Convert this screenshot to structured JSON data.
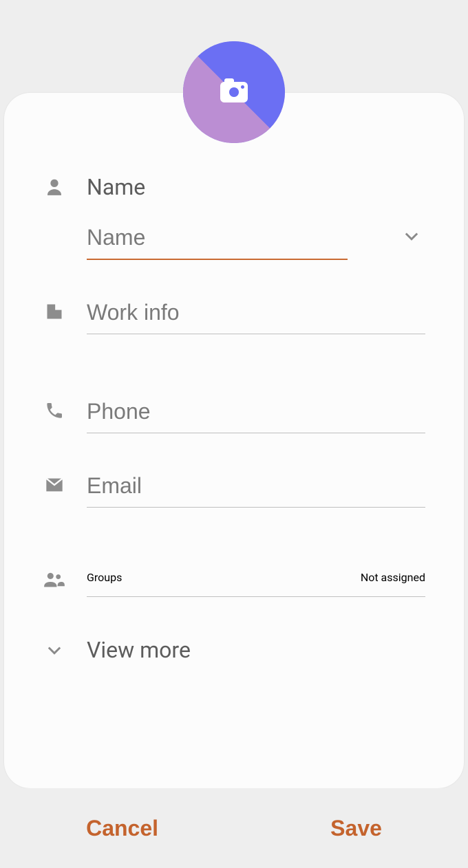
{
  "colors": {
    "accent": "#c4632d"
  },
  "avatar": {
    "icon": "camera-icon"
  },
  "fields": {
    "name": {
      "label": "Name",
      "placeholder": "Name",
      "value": "",
      "icon": "person-icon",
      "expand_icon": "chevron-down-icon"
    },
    "work": {
      "placeholder": "Work info",
      "value": "",
      "icon": "building-icon"
    },
    "phone": {
      "placeholder": "Phone",
      "value": "",
      "icon": "phone-icon"
    },
    "email": {
      "placeholder": "Email",
      "value": "",
      "icon": "mail-icon"
    },
    "groups": {
      "label": "Groups",
      "value": "Not assigned",
      "icon": "group-icon"
    }
  },
  "view_more": {
    "label": "View more",
    "icon": "chevron-down-icon"
  },
  "footer": {
    "cancel": "Cancel",
    "save": "Save"
  }
}
